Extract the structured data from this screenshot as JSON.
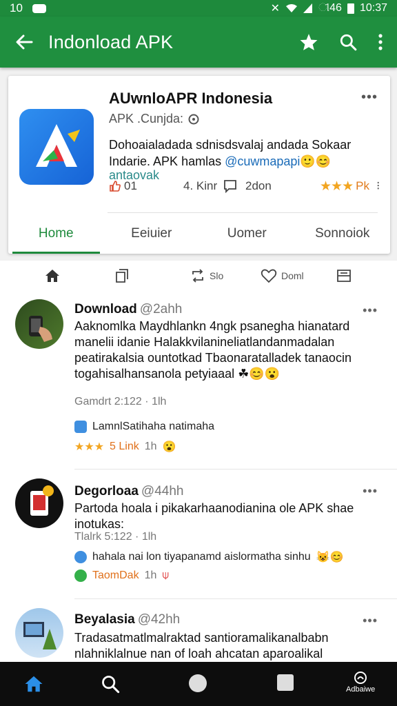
{
  "status": {
    "left_text": "10",
    "carrier": "ୀ46",
    "time": "10:37"
  },
  "appbar": {
    "title": "Indonload APK",
    "back_icon": "arrow-left-icon",
    "icons": [
      "star-icon",
      "search-icon",
      "overflow-menu-icon"
    ]
  },
  "app_card": {
    "name": "AUwnloAPR Indonesia",
    "subtitle": "APK .Cunjda:",
    "description_line1": "Dohoaialadada sdnisdsvalaj andada Sokaar",
    "description_line2_a": "Indarie. APK hamlas ",
    "description_line2_b": "@cuwmapapi",
    "link": "antaovak",
    "stats": {
      "likes": "01",
      "downloads": "4. Kinr",
      "comments": "2don",
      "rating": "Pk"
    },
    "tabs": [
      "Home",
      "Eeiuier",
      "Uomer",
      "Sonnoiok"
    ],
    "active_tab": 0
  },
  "toolbar": {
    "repost": "Slo",
    "like": "Doml"
  },
  "posts": [
    {
      "author": "Download",
      "handle": "@2ahh",
      "body": "Aaknomlka Maydhlankn 4ngk psanegha hianatard manelii idanie Halakkvilanineliatlandanmadalan peatirakalsia ountotkad Tbaonaratalladek tanaocin togahisalhansanola petyiaaal",
      "meta": "Gamdrt 2:122 · 1lh",
      "line1": "LamnlSatihaha natimaha",
      "line2": "5 Link",
      "line2_time": "1h"
    },
    {
      "author": "Degorloaa",
      "handle": "@44hh",
      "body": "Partoda hoala i pikakarhaanodianina ole APK shae inotukas:",
      "meta": "Tlalrk 5:122 · 1lh",
      "line1": "hahala nai lon tiyapanamd aislormatha sinhu",
      "line2": "TaomDak",
      "line2_time": "1h"
    },
    {
      "author": "Beyalasia",
      "handle": "@42hh",
      "body": "Tradasatmatlmalraktad santioramalikanalbabn nlahniklalnue nan of loah ahcatan aparoalikal"
    }
  ],
  "bottom_nav": {
    "last_label": "Adbaiwe",
    "icons": [
      "home-icon",
      "search-icon",
      "circle-icon",
      "square-icon",
      "profile-icon"
    ]
  },
  "colors": {
    "primary": "#1f8f3f",
    "accent_star": "#f2a521"
  }
}
